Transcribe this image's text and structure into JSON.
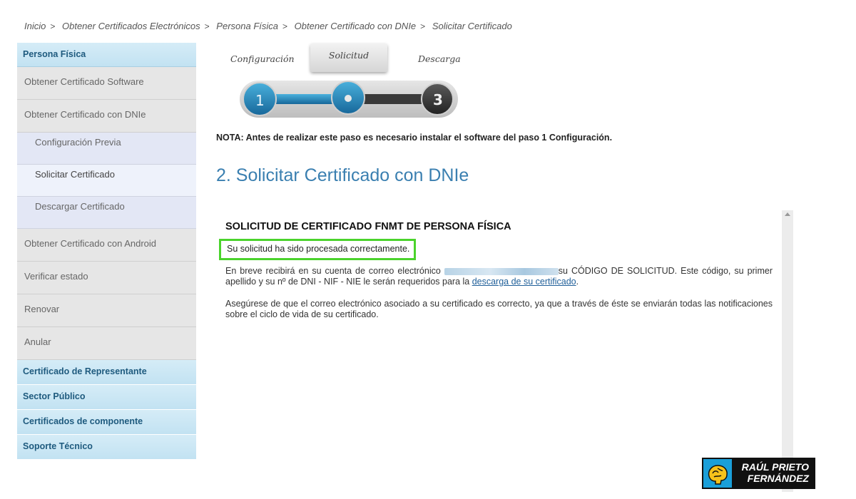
{
  "breadcrumb": {
    "items": [
      "Inicio",
      "Obtener Certificados Electrónicos",
      "Persona Física",
      "Obtener Certificado con DNIe",
      "Solicitar Certificado"
    ],
    "separator": ">"
  },
  "sidebar": {
    "header": "Persona Física",
    "items": [
      "Obtener Certificado Software",
      "Obtener Certificado con DNIe"
    ],
    "subitems": [
      "Configuración Previa",
      "Solicitar Certificado",
      "Descargar Certificado"
    ],
    "items_after": [
      "Obtener Certificado con Android",
      "Verificar estado",
      "Renovar",
      "Anular"
    ],
    "sections": [
      "Certificado de Representante",
      "Sector Público",
      "Certificados de componente",
      "Soporte Técnico"
    ]
  },
  "steps": {
    "labels": [
      "Configuración",
      "Solicitud",
      "Descarga"
    ],
    "numbers": [
      "1",
      "3"
    ],
    "active": "Solicitud"
  },
  "note": "NOTA: Antes de realizar este paso es necesario instalar el software del paso 1 Configuración.",
  "title": "2. Solicitar Certificado con DNIe",
  "content": {
    "heading": "SOLICITUD DE CERTIFICADO FNMT DE PERSONA FÍSICA",
    "success": "Su solicitud ha sido procesada correctamente.",
    "para1_start": "En breve recibirá en su cuenta de correo electrónico",
    "para1_mid": "su CÓDIGO DE SOLICITUD. Este código, su primer apellido y su nº de DNI - NIF - NIE le serán requeridos para la",
    "para1_link": "descarga de su certificado",
    "para1_end": ".",
    "para2": "Asegúrese de que el correo electrónico asociado a su certificado es correcto, ya que a través de éste se enviarán todas las notificaciones sobre el ciclo de vida de su certificado."
  },
  "watermark": {
    "line1": "RAÚL PRIETO",
    "line2": "FERNÁNDEZ"
  },
  "colors": {
    "accent": "#3a7fb0",
    "success_border": "#4bd32c",
    "sidebar_header": "#c2e2f2",
    "step_blue": "#1f7fb3",
    "step_dark": "#3c3c3c"
  }
}
